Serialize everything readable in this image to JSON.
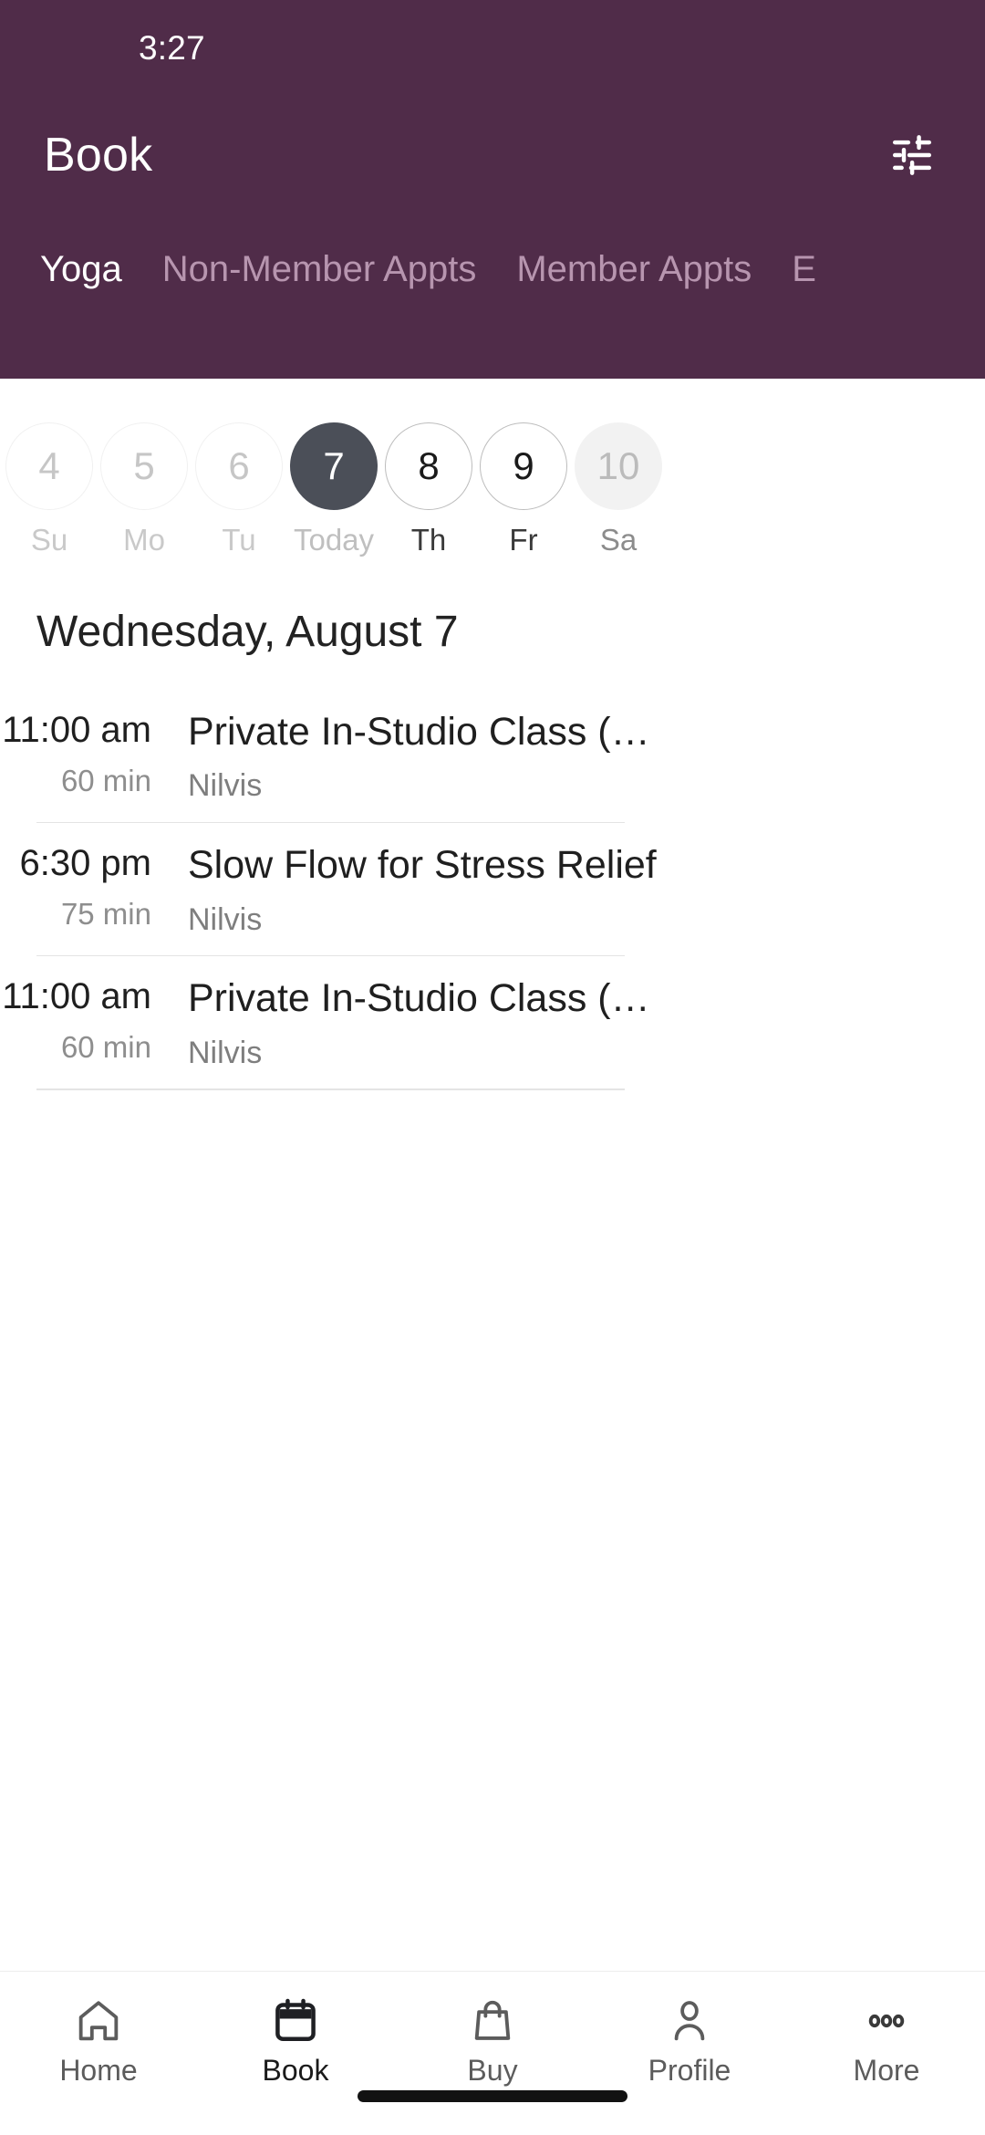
{
  "statusbar": {
    "time": "3:27"
  },
  "header": {
    "title": "Book",
    "filter_icon": "tune-icon",
    "accent_color": "#502C49",
    "tabs": [
      {
        "label": "Yoga",
        "active": true
      },
      {
        "label": "Non-Member Appts",
        "active": false
      },
      {
        "label": "Member Appts",
        "active": false
      },
      {
        "label": "E",
        "active": false
      }
    ]
  },
  "date_strip": {
    "days": [
      {
        "num": "4",
        "label": "Su",
        "state": "past"
      },
      {
        "num": "5",
        "label": "Mo",
        "state": "past"
      },
      {
        "num": "6",
        "label": "Tu",
        "state": "past"
      },
      {
        "num": "7",
        "label": "Today",
        "state": "today"
      },
      {
        "num": "8",
        "label": "Th",
        "state": "future"
      },
      {
        "num": "9",
        "label": "Fr",
        "state": "future"
      },
      {
        "num": "10",
        "label": "Sa",
        "state": "soft"
      }
    ],
    "selected_color": "#4B4F58"
  },
  "schedule": {
    "day_heading": "Wednesday, August 7",
    "classes": [
      {
        "time": "11:00 am",
        "duration": "60 min",
        "title": "Private In-Studio Class (…",
        "teacher": "Nilvis"
      },
      {
        "time": "6:30 pm",
        "duration": "75 min",
        "title": "Slow Flow for Stress Relief",
        "teacher": "Nilvis"
      },
      {
        "time": "11:00 am",
        "duration": "60 min",
        "title": "Private In-Studio Class (…",
        "teacher": "Nilvis"
      }
    ]
  },
  "bottom_nav": {
    "items": [
      {
        "label": "Home",
        "icon": "home-icon",
        "active": false
      },
      {
        "label": "Book",
        "icon": "calendar-icon",
        "active": true
      },
      {
        "label": "Buy",
        "icon": "bag-icon",
        "active": false
      },
      {
        "label": "Profile",
        "icon": "person-icon",
        "active": false
      },
      {
        "label": "More",
        "icon": "ellipsis-icon",
        "active": false
      }
    ]
  }
}
